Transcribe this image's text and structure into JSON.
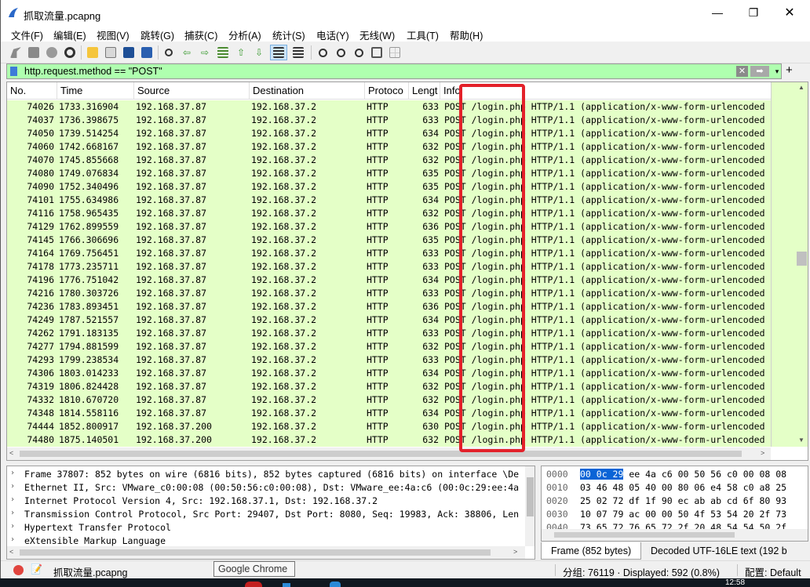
{
  "window": {
    "title": "抓取流量.pcapng",
    "min_glyph": "—",
    "max_glyph": "❐",
    "close_glyph": "✕"
  },
  "menu": [
    "文件(F)",
    "编辑(E)",
    "视图(V)",
    "跳转(G)",
    "捕获(C)",
    "分析(A)",
    "统计(S)",
    "电话(Y)",
    "无线(W)",
    "工具(T)",
    "帮助(H)"
  ],
  "toolbar_icons": [
    "shark-start-icon",
    "stop-icon",
    "restart-icon",
    "options-gear-icon",
    "open-file-icon",
    "save-file-icon",
    "close-file-icon",
    "reload-icon",
    "find-icon",
    "back-icon",
    "forward-icon",
    "go-to-packet-icon",
    "first-packet-icon",
    "last-packet-icon",
    "autoscroll-icon",
    "colorize-icon",
    "zoom-in-icon",
    "zoom-out-icon",
    "zoom-normal-icon",
    "resize-columns-icon",
    "layout-icon"
  ],
  "filter": {
    "value": "http.request.method == \"POST\"",
    "clear_glyph": "✕",
    "apply_glyph": "➡",
    "dropdown_glyph": "▾",
    "add_glyph": "+"
  },
  "columns": [
    "No.",
    "Time",
    "Source",
    "Destination",
    "Protoco",
    "Lengt",
    "Info"
  ],
  "rows": [
    [
      "74026",
      "1733.316904",
      "192.168.37.87",
      "192.168.37.2",
      "HTTP",
      "633",
      "POST /login.php HTTP/1.1  (application/x-www-form-urlencoded"
    ],
    [
      "74037",
      "1736.398675",
      "192.168.37.87",
      "192.168.37.2",
      "HTTP",
      "633",
      "POST /login.php HTTP/1.1  (application/x-www-form-urlencoded"
    ],
    [
      "74050",
      "1739.514254",
      "192.168.37.87",
      "192.168.37.2",
      "HTTP",
      "634",
      "POST /login.php HTTP/1.1  (application/x-www-form-urlencoded"
    ],
    [
      "74060",
      "1742.668167",
      "192.168.37.87",
      "192.168.37.2",
      "HTTP",
      "632",
      "POST /login.php HTTP/1.1  (application/x-www-form-urlencoded"
    ],
    [
      "74070",
      "1745.855668",
      "192.168.37.87",
      "192.168.37.2",
      "HTTP",
      "632",
      "POST /login.php HTTP/1.1  (application/x-www-form-urlencoded"
    ],
    [
      "74080",
      "1749.076834",
      "192.168.37.87",
      "192.168.37.2",
      "HTTP",
      "635",
      "POST /login.php HTTP/1.1  (application/x-www-form-urlencoded"
    ],
    [
      "74090",
      "1752.340496",
      "192.168.37.87",
      "192.168.37.2",
      "HTTP",
      "635",
      "POST /login.php HTTP/1.1  (application/x-www-form-urlencoded"
    ],
    [
      "74101",
      "1755.634986",
      "192.168.37.87",
      "192.168.37.2",
      "HTTP",
      "634",
      "POST /login.php HTTP/1.1  (application/x-www-form-urlencoded"
    ],
    [
      "74116",
      "1758.965435",
      "192.168.37.87",
      "192.168.37.2",
      "HTTP",
      "632",
      "POST /login.php HTTP/1.1  (application/x-www-form-urlencoded"
    ],
    [
      "74129",
      "1762.899559",
      "192.168.37.87",
      "192.168.37.2",
      "HTTP",
      "636",
      "POST /login.php HTTP/1.1  (application/x-www-form-urlencoded"
    ],
    [
      "74145",
      "1766.306696",
      "192.168.37.87",
      "192.168.37.2",
      "HTTP",
      "635",
      "POST /login.php HTTP/1.1  (application/x-www-form-urlencoded"
    ],
    [
      "74164",
      "1769.756451",
      "192.168.37.87",
      "192.168.37.2",
      "HTTP",
      "633",
      "POST /login.php HTTP/1.1  (application/x-www-form-urlencoded"
    ],
    [
      "74178",
      "1773.235711",
      "192.168.37.87",
      "192.168.37.2",
      "HTTP",
      "633",
      "POST /login.php HTTP/1.1  (application/x-www-form-urlencoded"
    ],
    [
      "74196",
      "1776.751042",
      "192.168.37.87",
      "192.168.37.2",
      "HTTP",
      "634",
      "POST /login.php HTTP/1.1  (application/x-www-form-urlencoded"
    ],
    [
      "74216",
      "1780.303726",
      "192.168.37.87",
      "192.168.37.2",
      "HTTP",
      "633",
      "POST /login.php HTTP/1.1  (application/x-www-form-urlencoded"
    ],
    [
      "74236",
      "1783.893451",
      "192.168.37.87",
      "192.168.37.2",
      "HTTP",
      "636",
      "POST /login.php HTTP/1.1  (application/x-www-form-urlencoded"
    ],
    [
      "74249",
      "1787.521557",
      "192.168.37.87",
      "192.168.37.2",
      "HTTP",
      "634",
      "POST /login.php HTTP/1.1  (application/x-www-form-urlencoded"
    ],
    [
      "74262",
      "1791.183135",
      "192.168.37.87",
      "192.168.37.2",
      "HTTP",
      "633",
      "POST /login.php HTTP/1.1  (application/x-www-form-urlencoded"
    ],
    [
      "74277",
      "1794.881599",
      "192.168.37.87",
      "192.168.37.2",
      "HTTP",
      "632",
      "POST /login.php HTTP/1.1  (application/x-www-form-urlencoded"
    ],
    [
      "74293",
      "1799.238534",
      "192.168.37.87",
      "192.168.37.2",
      "HTTP",
      "633",
      "POST /login.php HTTP/1.1  (application/x-www-form-urlencoded"
    ],
    [
      "74306",
      "1803.014233",
      "192.168.37.87",
      "192.168.37.2",
      "HTTP",
      "634",
      "POST /login.php HTTP/1.1  (application/x-www-form-urlencoded"
    ],
    [
      "74319",
      "1806.824428",
      "192.168.37.87",
      "192.168.37.2",
      "HTTP",
      "632",
      "POST /login.php HTTP/1.1  (application/x-www-form-urlencoded"
    ],
    [
      "74332",
      "1810.670720",
      "192.168.37.87",
      "192.168.37.2",
      "HTTP",
      "632",
      "POST /login.php HTTP/1.1  (application/x-www-form-urlencoded"
    ],
    [
      "74348",
      "1814.558116",
      "192.168.37.87",
      "192.168.37.2",
      "HTTP",
      "634",
      "POST /login.php HTTP/1.1  (application/x-www-form-urlencoded"
    ],
    [
      "74444",
      "1852.800917",
      "192.168.37.200",
      "192.168.37.2",
      "HTTP",
      "630",
      "POST /login.php HTTP/1.1  (application/x-www-form-urlencoded"
    ],
    [
      "74480",
      "1875.140501",
      "192.168.37.200",
      "192.168.37.2",
      "HTTP",
      "632",
      "POST /login.php HTTP/1.1  (application/x-www-form-urlencoded"
    ]
  ],
  "details": [
    "Frame 37807: 852 bytes on wire (6816 bits), 852 bytes captured (6816 bits) on interface \\De",
    "Ethernet II, Src: VMware_c0:00:08 (00:50:56:c0:00:08), Dst: VMware_ee:4a:c6 (00:0c:29:ee:4a",
    "Internet Protocol Version 4, Src: 192.168.37.1, Dst: 192.168.37.2",
    "Transmission Control Protocol, Src Port: 29407, Dst Port: 8080, Seq: 19983, Ack: 38806, Len",
    "Hypertext Transfer Protocol",
    "eXtensible Markup Language"
  ],
  "bytes": {
    "first_line": {
      "offset": "0000",
      "highlight": "00 0c 29",
      "rest": " ee 4a c6 00 50  56 c0 00 08 08"
    },
    "lines": [
      {
        "offset": "0010",
        "hex": "03 46 48 05 40 00 80 06  e4 58 c0 a8 25"
      },
      {
        "offset": "0020",
        "hex": "25 02 72 df 1f 90 ec ab  ab cd 6f 80 93"
      },
      {
        "offset": "0030",
        "hex": "10 07 79 ac 00 00 50 4f  53 54 20 2f 73"
      },
      {
        "offset": "0040",
        "hex": "73 65 72 76 65 72 2f 20  48 54 54 50 2f"
      }
    ]
  },
  "byte_tabs": [
    "Frame (852 bytes)",
    "Decoded UTF-16LE text (192 b"
  ],
  "status": {
    "file": "抓取流量.pcapng",
    "counts": "分组: 76119 · Displayed: 592 (0.8%)",
    "profile": "配置: Default"
  },
  "tooltip": "Google Chrome",
  "taskbar": {
    "clock": "12:58"
  }
}
